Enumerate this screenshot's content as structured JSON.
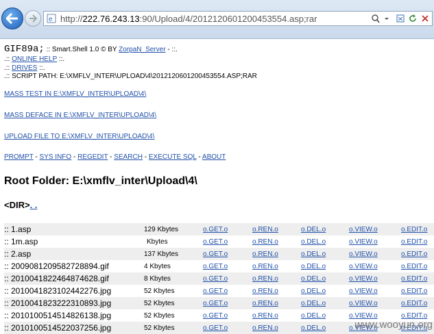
{
  "browser": {
    "url_prefix": "http://",
    "url_host": "222.76.243.13",
    "url_rest": ":90/Upload/4/2012120601200453554.asp;rar"
  },
  "header": {
    "gif_tag": "GIF89a;",
    "title_prefix": ":: Smart.Shell 1.0 © BY",
    "author": "ZorpaN_Server",
    "title_suffix": "- ::.",
    "help_prefix": ".::",
    "help_link": "ONLINE HELP",
    "help_suffix": "::.",
    "drives_prefix": ".::",
    "drives_link": "DRIVES",
    "drives_suffix": "::.",
    "script_path": ".:: SCRIPT PATH: E:\\XMFLV_INTER\\UPLOAD\\4\\2012120601200453554.ASP;RAR"
  },
  "actions": {
    "mass_test": "MASS TEST IN E:\\XMFLV_INTER\\UPLOAD\\4\\",
    "mass_deface": "MASS DEFACE IN E:\\XMFLV_INTER\\UPLOAD\\4\\",
    "upload": "UPLOAD FILE TO E:\\XMFLV_INTER\\UPLOAD\\4\\"
  },
  "menu": {
    "prompt": "PROMPT",
    "sysinfo": "SYS INFO",
    "regedit": "REGEDIT",
    "search": "SEARCH",
    "exec_sql": "EXECUTE SQL",
    "about": "ABOUT",
    "sep": "-"
  },
  "folder": {
    "title": "Root Folder: E:\\xmflv_inter\\Upload\\4\\",
    "dir_label": "<DIR>",
    "dir_link": ". ."
  },
  "file_actions": [
    "o.GET.o",
    "o.REN.o",
    "o.DEL.o",
    "o.VIEW.o",
    "o.EDIT.o"
  ],
  "files": [
    {
      "name": ":: 1.asp",
      "size": "129 Kbytes"
    },
    {
      "name": ":: 1m.asp",
      "size": "Kbytes"
    },
    {
      "name": ":: 2.asp",
      "size": "137 Kbytes"
    },
    {
      "name": ":: 2009081209582728894.gif",
      "size": "4 Kbytes"
    },
    {
      "name": ":: 2010041822464874628.gif",
      "size": "8 Kbytes"
    },
    {
      "name": ":: 2010041823102442276.jpg",
      "size": "52 Kbytes"
    },
    {
      "name": ":: 2010041823222310893.jpg",
      "size": "52 Kbytes"
    },
    {
      "name": ":: 2010100514514826138.jpg",
      "size": "52 Kbytes"
    },
    {
      "name": ":: 2010100514522037256.jpg",
      "size": "52 Kbytes"
    }
  ],
  "watermark": "www.wooyun.org"
}
